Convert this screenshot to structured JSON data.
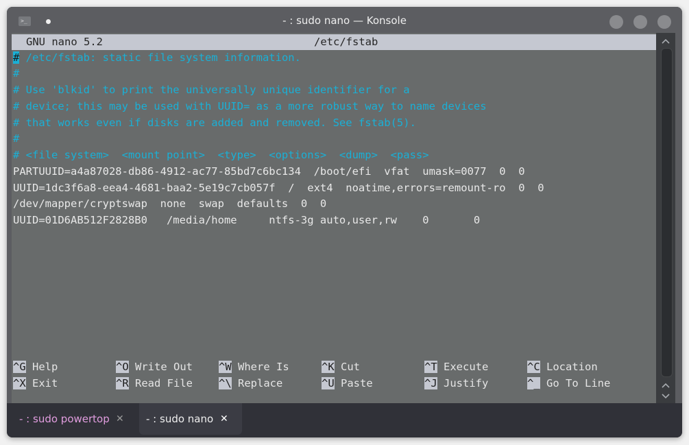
{
  "window": {
    "title": "- : sudo nano — Konsole",
    "app_icon": "terminal-icon",
    "controls": [
      "minimize-button",
      "maximize-button",
      "close-button"
    ]
  },
  "nano": {
    "header": {
      "version": "GNU nano 5.2",
      "filename": "/etc/fstab"
    },
    "lines": [
      {
        "text": " /etc/fstab: static file system information.",
        "type": "comment",
        "cursor_char": "#"
      },
      {
        "text": "#",
        "type": "comment"
      },
      {
        "text": "# Use 'blkid' to print the universally unique identifier for a",
        "type": "comment"
      },
      {
        "text": "# device; this may be used with UUID= as a more robust way to name devices",
        "type": "comment"
      },
      {
        "text": "# that works even if disks are added and removed. See fstab(5).",
        "type": "comment"
      },
      {
        "text": "#",
        "type": "comment"
      },
      {
        "text": "# <file system>  <mount point>  <type>  <options>  <dump>  <pass>",
        "type": "comment"
      },
      {
        "text": "PARTUUID=a4a87028-db86-4912-ac77-85bd7c6bc134  /boot/efi  vfat  umask=0077  0  0",
        "type": "normal"
      },
      {
        "text": "UUID=1dc3f6a8-eea4-4681-baa2-5e19c7cb057f  /  ext4  noatime,errors=remount-ro  0  0",
        "type": "normal"
      },
      {
        "text": "/dev/mapper/cryptswap  none  swap  defaults  0  0",
        "type": "normal"
      },
      {
        "text": "UUID=01D6AB512F2828B0   /media/home     ntfs-3g auto,user,rw    0       0",
        "type": "normal"
      }
    ],
    "shortcuts": [
      {
        "key": "^G",
        "label": "Help"
      },
      {
        "key": "^O",
        "label": "Write Out"
      },
      {
        "key": "^W",
        "label": "Where Is"
      },
      {
        "key": "^K",
        "label": "Cut"
      },
      {
        "key": "^T",
        "label": "Execute"
      },
      {
        "key": "^C",
        "label": "Location"
      },
      {
        "key": "^X",
        "label": "Exit"
      },
      {
        "key": "^R",
        "label": "Read File"
      },
      {
        "key": "^\\",
        "label": "Replace"
      },
      {
        "key": "^U",
        "label": "Paste"
      },
      {
        "key": "^J",
        "label": "Justify"
      },
      {
        "key": "^_",
        "label": "Go To Line"
      }
    ]
  },
  "scrollbar": {
    "up_glyph": "^",
    "down_glyph": "v"
  },
  "tabs": [
    {
      "label": "- : sudo powertop",
      "close": "✕",
      "active": false
    },
    {
      "label": "- : sudo nano",
      "close": "✕",
      "active": true
    }
  ],
  "colors": {
    "terminal_bg": "#686b6b",
    "comment": "#1ab0d6",
    "header_bg": "#c5c8d1",
    "inactive_tab_text": "#e19ddf",
    "tabbar_bg": "#303138"
  }
}
